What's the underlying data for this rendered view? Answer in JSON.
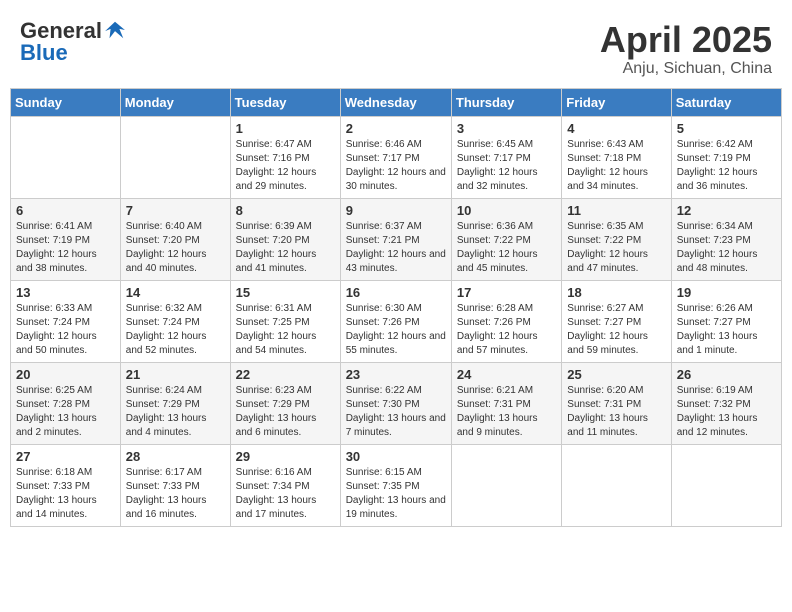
{
  "header": {
    "logo_general": "General",
    "logo_blue": "Blue",
    "month_title": "April 2025",
    "location": "Anju, Sichuan, China"
  },
  "weekdays": [
    "Sunday",
    "Monday",
    "Tuesday",
    "Wednesday",
    "Thursday",
    "Friday",
    "Saturday"
  ],
  "weeks": [
    [
      {
        "day": "",
        "info": ""
      },
      {
        "day": "",
        "info": ""
      },
      {
        "day": "1",
        "info": "Sunrise: 6:47 AM\nSunset: 7:16 PM\nDaylight: 12 hours and 29 minutes."
      },
      {
        "day": "2",
        "info": "Sunrise: 6:46 AM\nSunset: 7:17 PM\nDaylight: 12 hours and 30 minutes."
      },
      {
        "day": "3",
        "info": "Sunrise: 6:45 AM\nSunset: 7:17 PM\nDaylight: 12 hours and 32 minutes."
      },
      {
        "day": "4",
        "info": "Sunrise: 6:43 AM\nSunset: 7:18 PM\nDaylight: 12 hours and 34 minutes."
      },
      {
        "day": "5",
        "info": "Sunrise: 6:42 AM\nSunset: 7:19 PM\nDaylight: 12 hours and 36 minutes."
      }
    ],
    [
      {
        "day": "6",
        "info": "Sunrise: 6:41 AM\nSunset: 7:19 PM\nDaylight: 12 hours and 38 minutes."
      },
      {
        "day": "7",
        "info": "Sunrise: 6:40 AM\nSunset: 7:20 PM\nDaylight: 12 hours and 40 minutes."
      },
      {
        "day": "8",
        "info": "Sunrise: 6:39 AM\nSunset: 7:20 PM\nDaylight: 12 hours and 41 minutes."
      },
      {
        "day": "9",
        "info": "Sunrise: 6:37 AM\nSunset: 7:21 PM\nDaylight: 12 hours and 43 minutes."
      },
      {
        "day": "10",
        "info": "Sunrise: 6:36 AM\nSunset: 7:22 PM\nDaylight: 12 hours and 45 minutes."
      },
      {
        "day": "11",
        "info": "Sunrise: 6:35 AM\nSunset: 7:22 PM\nDaylight: 12 hours and 47 minutes."
      },
      {
        "day": "12",
        "info": "Sunrise: 6:34 AM\nSunset: 7:23 PM\nDaylight: 12 hours and 48 minutes."
      }
    ],
    [
      {
        "day": "13",
        "info": "Sunrise: 6:33 AM\nSunset: 7:24 PM\nDaylight: 12 hours and 50 minutes."
      },
      {
        "day": "14",
        "info": "Sunrise: 6:32 AM\nSunset: 7:24 PM\nDaylight: 12 hours and 52 minutes."
      },
      {
        "day": "15",
        "info": "Sunrise: 6:31 AM\nSunset: 7:25 PM\nDaylight: 12 hours and 54 minutes."
      },
      {
        "day": "16",
        "info": "Sunrise: 6:30 AM\nSunset: 7:26 PM\nDaylight: 12 hours and 55 minutes."
      },
      {
        "day": "17",
        "info": "Sunrise: 6:28 AM\nSunset: 7:26 PM\nDaylight: 12 hours and 57 minutes."
      },
      {
        "day": "18",
        "info": "Sunrise: 6:27 AM\nSunset: 7:27 PM\nDaylight: 12 hours and 59 minutes."
      },
      {
        "day": "19",
        "info": "Sunrise: 6:26 AM\nSunset: 7:27 PM\nDaylight: 13 hours and 1 minute."
      }
    ],
    [
      {
        "day": "20",
        "info": "Sunrise: 6:25 AM\nSunset: 7:28 PM\nDaylight: 13 hours and 2 minutes."
      },
      {
        "day": "21",
        "info": "Sunrise: 6:24 AM\nSunset: 7:29 PM\nDaylight: 13 hours and 4 minutes."
      },
      {
        "day": "22",
        "info": "Sunrise: 6:23 AM\nSunset: 7:29 PM\nDaylight: 13 hours and 6 minutes."
      },
      {
        "day": "23",
        "info": "Sunrise: 6:22 AM\nSunset: 7:30 PM\nDaylight: 13 hours and 7 minutes."
      },
      {
        "day": "24",
        "info": "Sunrise: 6:21 AM\nSunset: 7:31 PM\nDaylight: 13 hours and 9 minutes."
      },
      {
        "day": "25",
        "info": "Sunrise: 6:20 AM\nSunset: 7:31 PM\nDaylight: 13 hours and 11 minutes."
      },
      {
        "day": "26",
        "info": "Sunrise: 6:19 AM\nSunset: 7:32 PM\nDaylight: 13 hours and 12 minutes."
      }
    ],
    [
      {
        "day": "27",
        "info": "Sunrise: 6:18 AM\nSunset: 7:33 PM\nDaylight: 13 hours and 14 minutes."
      },
      {
        "day": "28",
        "info": "Sunrise: 6:17 AM\nSunset: 7:33 PM\nDaylight: 13 hours and 16 minutes."
      },
      {
        "day": "29",
        "info": "Sunrise: 6:16 AM\nSunset: 7:34 PM\nDaylight: 13 hours and 17 minutes."
      },
      {
        "day": "30",
        "info": "Sunrise: 6:15 AM\nSunset: 7:35 PM\nDaylight: 13 hours and 19 minutes."
      },
      {
        "day": "",
        "info": ""
      },
      {
        "day": "",
        "info": ""
      },
      {
        "day": "",
        "info": ""
      }
    ]
  ]
}
